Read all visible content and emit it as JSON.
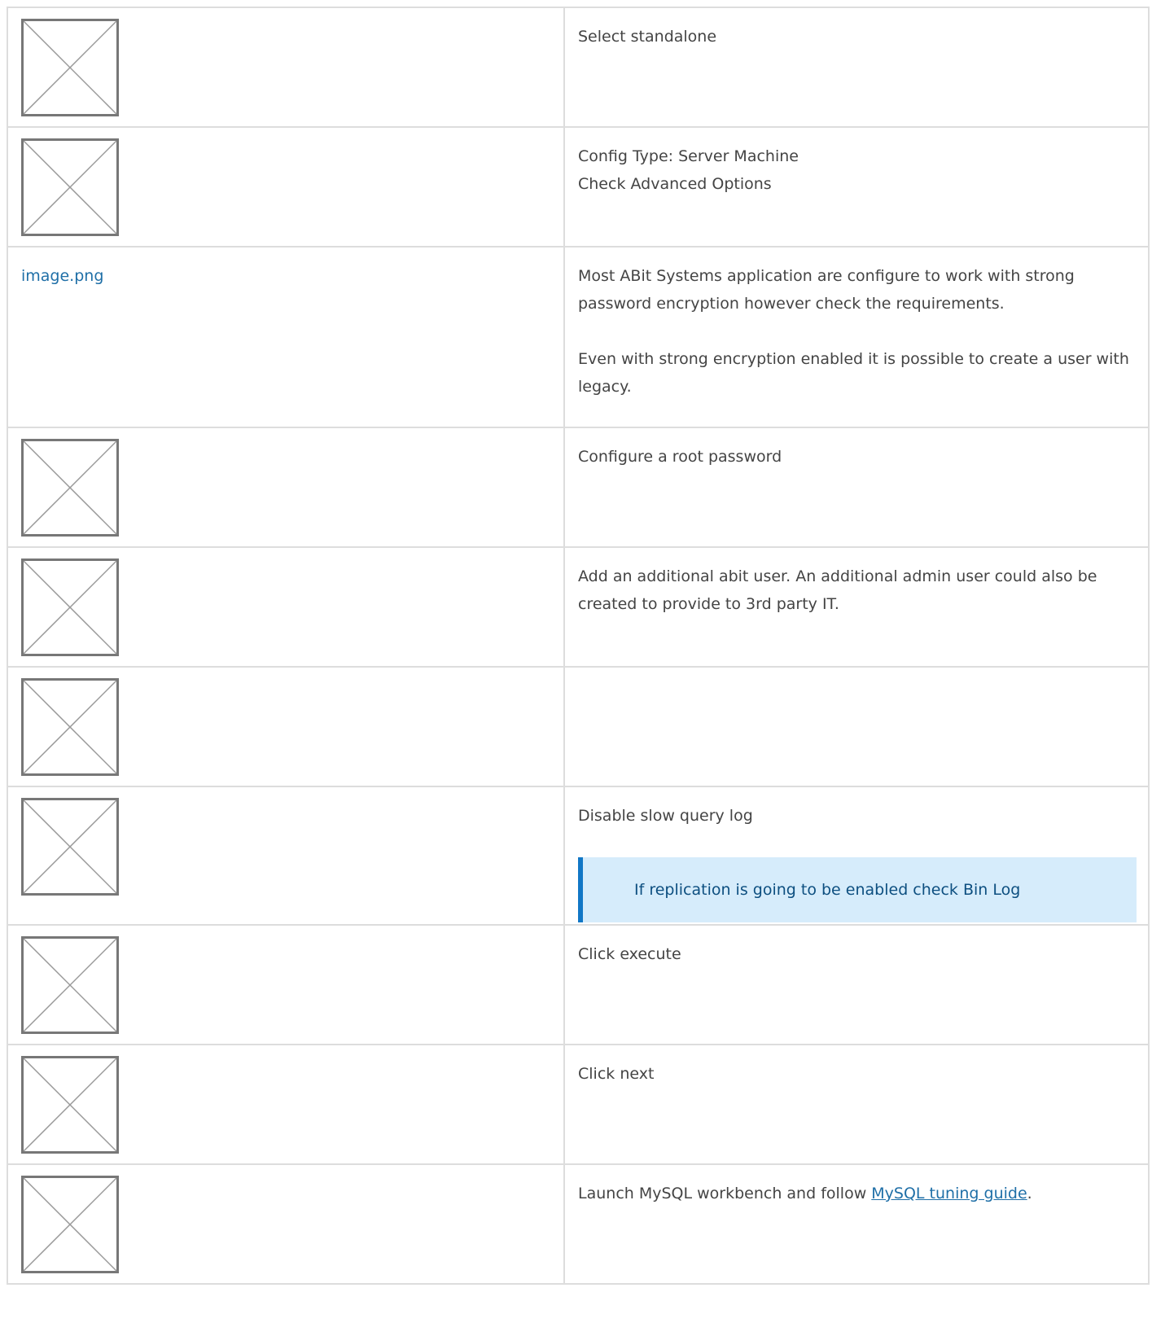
{
  "steps": [
    {
      "image": {
        "kind": "broken",
        "icon": "broken-image-icon"
      },
      "lines": [
        "Select standalone"
      ]
    },
    {
      "image": {
        "kind": "broken",
        "icon": "broken-image-icon"
      },
      "lines": [
        "Config Type: Server Machine",
        "Check Advanced Options"
      ]
    },
    {
      "image": {
        "kind": "link",
        "label": "image.png"
      },
      "paragraphs": [
        "Most ABit Systems application are configure to work with strong password encryption however check the requirements.",
        "Even with strong encryption enabled it is possible to create a user with legacy."
      ]
    },
    {
      "image": {
        "kind": "broken",
        "icon": "broken-image-icon"
      },
      "lines": [
        "Configure a root password"
      ]
    },
    {
      "image": {
        "kind": "broken",
        "icon": "broken-image-icon"
      },
      "lines": [
        "Add an additional abit user. An additional admin user could also be created to provide to 3rd party IT."
      ]
    },
    {
      "image": {
        "kind": "broken",
        "icon": "broken-image-icon"
      },
      "lines": [
        ""
      ]
    },
    {
      "image": {
        "kind": "broken",
        "icon": "broken-image-icon"
      },
      "lines": [
        "Disable slow query log"
      ],
      "info": "If replication is going to be enabled check Bin Log"
    },
    {
      "image": {
        "kind": "broken",
        "icon": "broken-image-icon"
      },
      "lines": [
        "Click execute"
      ]
    },
    {
      "image": {
        "kind": "broken",
        "icon": "broken-image-icon"
      },
      "lines": [
        "Click next"
      ]
    },
    {
      "image": {
        "kind": "broken",
        "icon": "broken-image-icon"
      },
      "text_before": "Launch MySQL workbench and follow ",
      "link": "MySQL tuning guide",
      "text_after": "."
    }
  ],
  "colors": {
    "text": "#444444",
    "link": "#1f6fa7",
    "border": "#dddddd",
    "info_bg": "#d6ecfb",
    "info_border": "#1177c6",
    "info_text": "#0d4f80",
    "placeholder_stroke": "#777777"
  }
}
